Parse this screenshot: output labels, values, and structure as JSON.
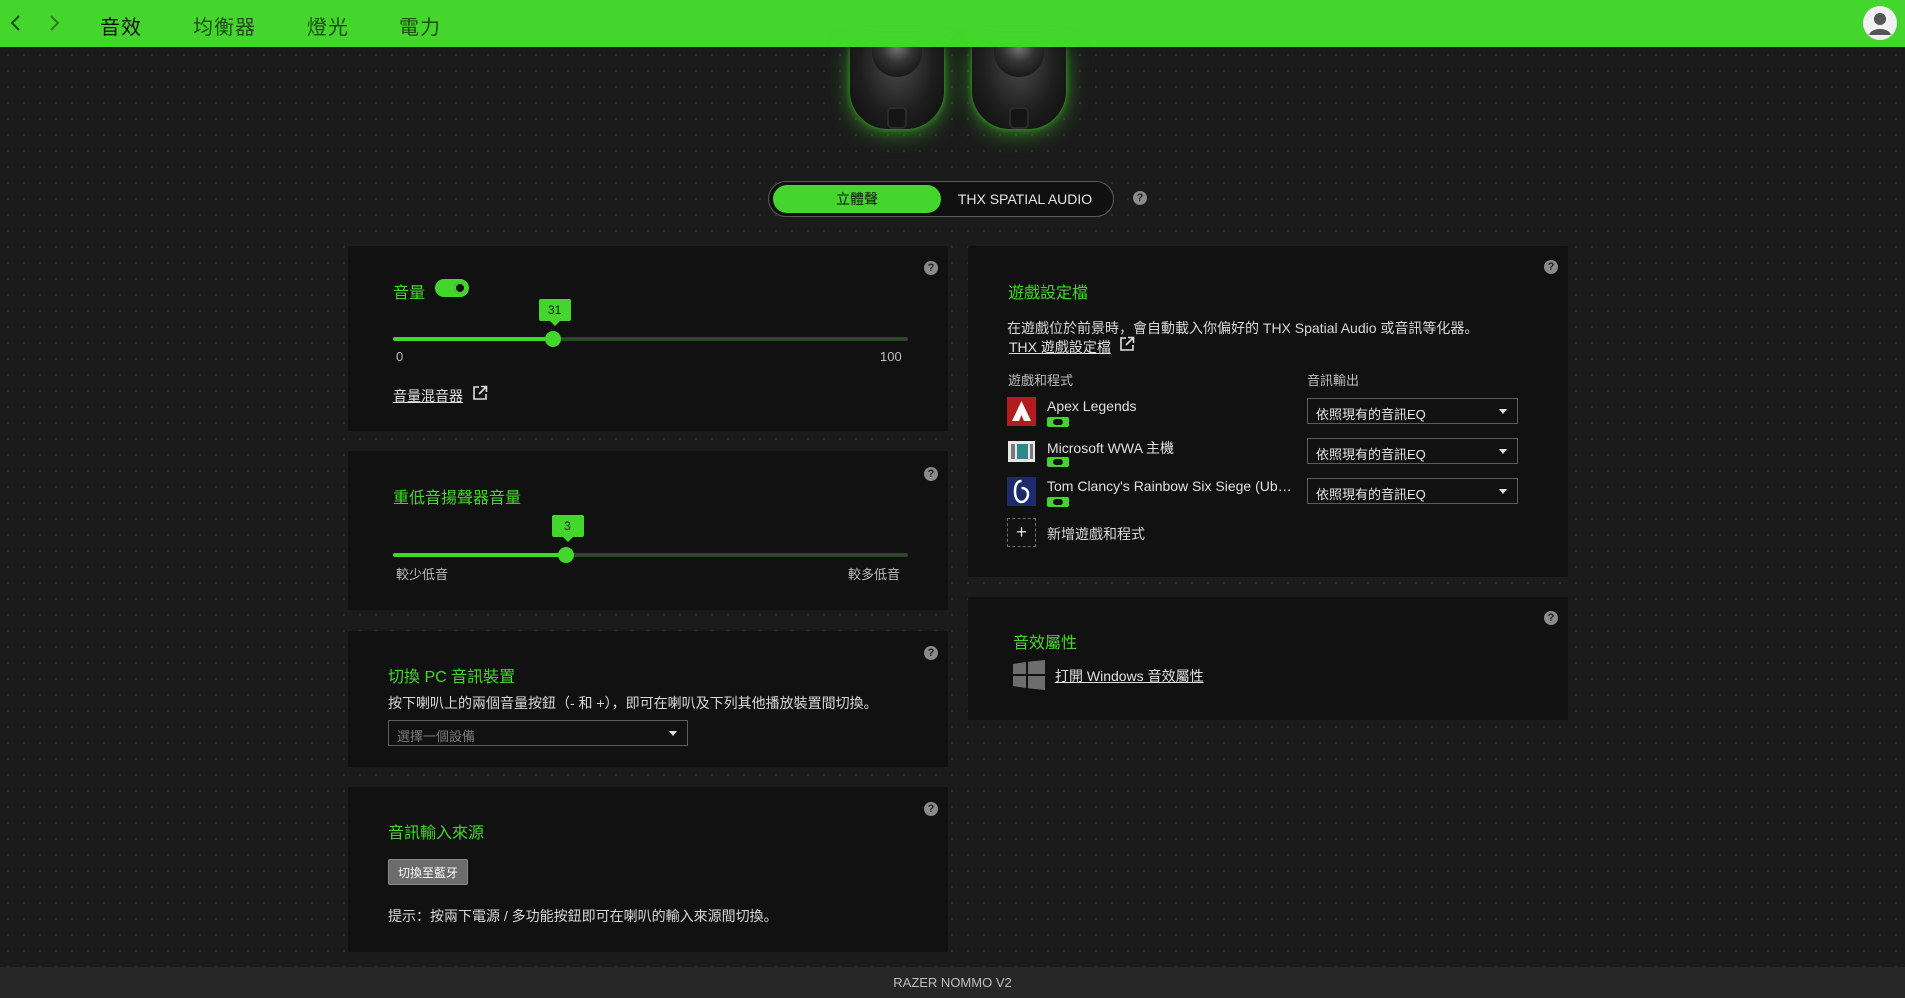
{
  "tabs": [
    {
      "label": "音效",
      "active": true
    },
    {
      "label": "均衡器",
      "active": false
    },
    {
      "label": "燈光",
      "active": false
    },
    {
      "label": "電力",
      "active": false
    }
  ],
  "mode": {
    "stereo": "立體聲",
    "thx": "THX SPATIAL AUDIO",
    "selected": "立體聲"
  },
  "volume": {
    "title": "音量",
    "enabled": true,
    "value": "31",
    "min_label": "0",
    "max_label": "100",
    "mixer_link": "音量混音器"
  },
  "bass": {
    "title": "重低音揚聲器音量",
    "value": "3",
    "min_label": "較少低音",
    "max_label": "較多低音"
  },
  "pc_audio": {
    "title": "切換 PC 音訊裝置",
    "desc": "按下喇叭上的兩個音量按鈕（- 和 +），即可在喇叭及下列其他播放裝置間切換。",
    "select_placeholder": "選擇一個設備"
  },
  "audio_input": {
    "title": "音訊輸入來源",
    "button": "切換至藍牙",
    "hint": "提示：按兩下電源 / 多功能按鈕即可在喇叭的輸入來源間切換。"
  },
  "game_profiles": {
    "title": "遊戲設定檔",
    "desc": "在遊戲位於前景時，會自動載入你偏好的 THX Spatial Audio 或音訊等化器。",
    "link": "THX 遊戲設定檔",
    "col_games": "遊戲和程式",
    "col_output": "音訊輸出",
    "games": [
      {
        "name": "Apex Legends",
        "output": "依照現有的音訊EQ",
        "icon": "apex-legends-icon"
      },
      {
        "name": "Microsoft WWA 主機",
        "output": "依照現有的音訊EQ",
        "icon": "microsoft-wwa-icon"
      },
      {
        "name": "Tom Clancy's Rainbow Six Siege (Ubisoft)",
        "output": "依照現有的音訊EQ",
        "icon": "rainbow-six-icon"
      }
    ],
    "add_label": "新增遊戲和程式"
  },
  "sound_properties": {
    "title": "音效屬性",
    "link": "打開 Windows 音效屬性"
  },
  "footer": {
    "device": "RAZER NOMMO V2"
  },
  "colors": {
    "accent": "#44d62c",
    "panel": "#111111",
    "background": "#1b1b1b"
  }
}
